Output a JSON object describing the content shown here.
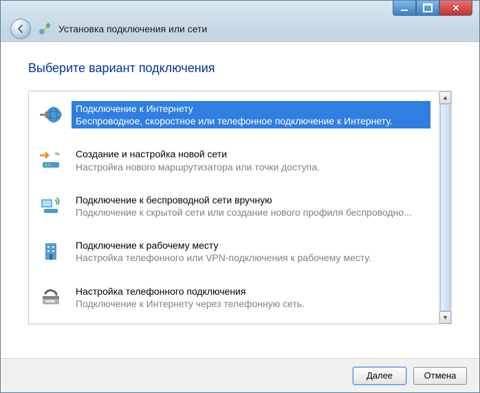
{
  "window": {
    "title": "Установка подключения или сети"
  },
  "heading": "Выберите вариант подключения",
  "options": [
    {
      "title": "Подключение к Интернету",
      "desc": "Беспроводное, скоростное или телефонное подключение к Интернету.",
      "icon": "globe-arrow-icon",
      "selected": true
    },
    {
      "title": "Создание и настройка новой сети",
      "desc": "Настройка нового маршрутизатора или точки доступа.",
      "icon": "router-icon",
      "selected": false
    },
    {
      "title": "Подключение к беспроводной сети вручную",
      "desc": "Подключение к скрытой сети или создание нового профиля беспроводно...",
      "icon": "wireless-pc-icon",
      "selected": false
    },
    {
      "title": "Подключение к рабочему месту",
      "desc": "Настройка телефонного или VPN-подключения к рабочему месту.",
      "icon": "building-icon",
      "selected": false
    },
    {
      "title": "Настройка телефонного подключения",
      "desc": "Подключение к Интернету через телефонную сеть.",
      "icon": "phone-modem-icon",
      "selected": false
    }
  ],
  "buttons": {
    "next": "Далее",
    "cancel": "Отмена"
  }
}
